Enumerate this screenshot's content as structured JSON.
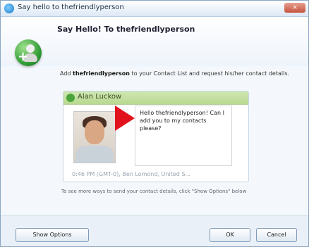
{
  "window": {
    "title": "Say hello to thefriendlyperson",
    "close_label": "×"
  },
  "header": {
    "title": "Say Hello! To thefriendlyperson"
  },
  "description": {
    "prefix": "Add ",
    "username": "thefriendlyperson",
    "suffix": " to your Contact List and request his/her contact details."
  },
  "contact": {
    "name": "Alan Luckow",
    "message": "Hello thefriendlyperson! Can I add you to my contacts please?",
    "location": "0:46 PM (GMT-0), Ben Lomond, United S..."
  },
  "hint": {
    "text": "To see more ways to send your contact details, click \"Show Options\" below"
  },
  "buttons": {
    "show_options": "Show Options",
    "ok": "OK",
    "cancel": "Cancel"
  },
  "icons": {
    "app": "app-icon",
    "add_contact": "add-contact-icon",
    "contact_status": "contact-status-icon",
    "pointer": "pointer-arrow-icon"
  },
  "colors": {
    "arrow": "#e2121d",
    "card_header": "#b9d990",
    "accent": "#1a79c7"
  }
}
